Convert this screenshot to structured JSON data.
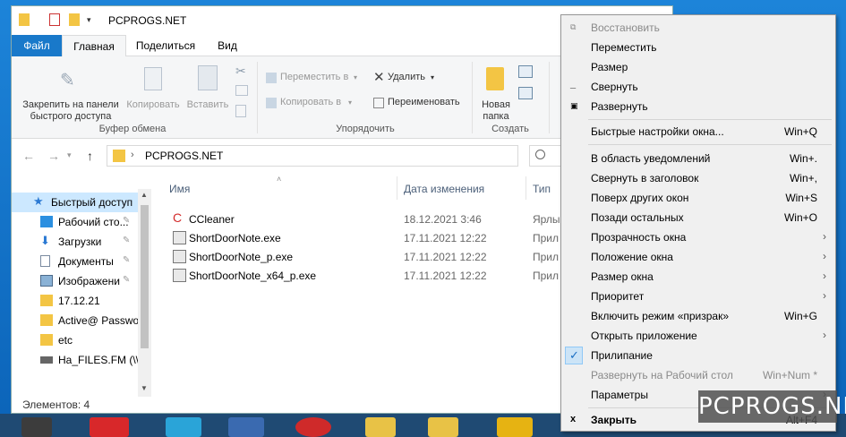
{
  "window": {
    "title": "PCPROGS.NET",
    "tabs": [
      {
        "label": "Файл"
      },
      {
        "label": "Главная"
      },
      {
        "label": "Поделиться"
      },
      {
        "label": "Вид"
      }
    ]
  },
  "ribbon": {
    "pin_label_1": "Закрепить на панели",
    "pin_label_2": "быстрого доступа",
    "copy_label": "Копировать",
    "paste_label": "Вставить",
    "clipboard_group": "Буфер обмена",
    "move_to": "Переместить в",
    "copy_to": "Копировать в",
    "delete": "Удалить",
    "rename": "Переименовать",
    "organize_group": "Упорядочить",
    "new_folder_1": "Новая",
    "new_folder_2": "папка",
    "create_group": "Создать"
  },
  "address": {
    "path": "PCPROGS.NET"
  },
  "sidebar": {
    "items": [
      {
        "label": "Быстрый доступ"
      },
      {
        "label": "Рабочий сто..."
      },
      {
        "label": "Загрузки"
      },
      {
        "label": "Документы"
      },
      {
        "label": "Изображени"
      },
      {
        "label": "17.12.21"
      },
      {
        "label": "Active@ Passwo"
      },
      {
        "label": "etc"
      },
      {
        "label": "Ha_FILES.FM (\\\\"
      }
    ]
  },
  "columns": {
    "name": "Имя",
    "date": "Дата изменения",
    "type": "Тип"
  },
  "files": [
    {
      "name": "CCleaner",
      "date": "18.12.2021 3:46",
      "type": "Ярлы"
    },
    {
      "name": "ShortDoorNote.exe",
      "date": "17.11.2021 12:22",
      "type": "Прил"
    },
    {
      "name": "ShortDoorNote_p.exe",
      "date": "17.11.2021 12:22",
      "type": "Прил"
    },
    {
      "name": "ShortDoorNote_x64_p.exe",
      "date": "17.11.2021 12:22",
      "type": "Прил"
    }
  ],
  "status": {
    "items_count": "Элементов: 4"
  },
  "menu": {
    "items": [
      {
        "label": "Восстановить",
        "shortcut": ""
      },
      {
        "label": "Переместить",
        "shortcut": ""
      },
      {
        "label": "Размер",
        "shortcut": ""
      },
      {
        "label": "Свернуть",
        "shortcut": ""
      },
      {
        "label": "Развернуть",
        "shortcut": ""
      },
      {
        "label": "Быстрые настройки окна...",
        "shortcut": "Win+Q"
      },
      {
        "label": "В область уведомлений",
        "shortcut": "Win+."
      },
      {
        "label": "Свернуть в заголовок",
        "shortcut": "Win+,"
      },
      {
        "label": "Поверх других окон",
        "shortcut": "Win+S"
      },
      {
        "label": "Позади остальных",
        "shortcut": "Win+O"
      },
      {
        "label": "Прозрачность окна",
        "shortcut": ""
      },
      {
        "label": "Положение окна",
        "shortcut": ""
      },
      {
        "label": "Размер окна",
        "shortcut": ""
      },
      {
        "label": "Приоритет",
        "shortcut": ""
      },
      {
        "label": "Включить режим «призрак»",
        "shortcut": "Win+G"
      },
      {
        "label": "Открыть приложение",
        "shortcut": ""
      },
      {
        "label": "Прилипание",
        "shortcut": ""
      },
      {
        "label": "Развернуть на Рабочий стол",
        "shortcut": "Win+Num *"
      },
      {
        "label": "Параметры",
        "shortcut": ""
      },
      {
        "label": "Закрыть",
        "shortcut": "Alt+F4"
      }
    ]
  },
  "watermark": "PCPROGS.NET",
  "colors": {
    "accent": "#1979ca",
    "selection": "#cce8ff",
    "menu_bg": "#f0f0f0"
  }
}
